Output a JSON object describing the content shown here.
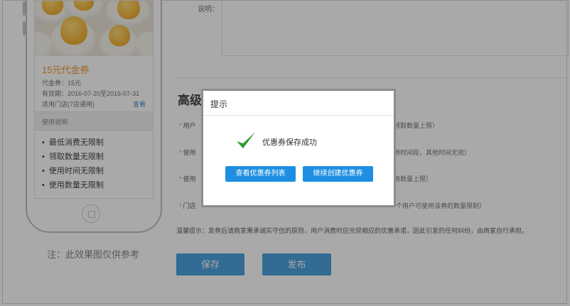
{
  "preview": {
    "coupon_title": "15元代金券",
    "face_value": "代金券：15元",
    "validity": "有效期：2016-07-20至2016-07-31",
    "stores": "适用门店(7店通用)",
    "view_link": "查看",
    "usage_header": "使用说明",
    "rules": [
      "最低消费无限制",
      "领取数量无限制",
      "使用时间无限制",
      "使用数量无限制"
    ],
    "note": "注：此效果图仅供参考"
  },
  "form": {
    "description_label": "说明：",
    "advanced_title": "高级",
    "fields": [
      {
        "label": "用户",
        "hint": "领取数量上限）"
      },
      {
        "label": "使用",
        "hint": "用时间段，其他时间无效）"
      },
      {
        "label": "使用",
        "hint": "用数量上限）"
      },
      {
        "label": "门店",
        "hint": "个用户可使用该券的数量限制）"
      }
    ],
    "tip": "温馨提示：发券后请商家秉承诚实守信的原则，用户消费时应兑现相应的优惠承诺，因此引发的任何纠纷，由商家自行承担。",
    "save_label": "保存",
    "publish_label": "发布"
  },
  "dialog": {
    "title": "提示",
    "message": "优惠券保存成功",
    "icon": "check-icon",
    "view_list_label": "查看优惠券列表",
    "create_more_label": "继续创建优惠券"
  },
  "colors": {
    "accent": "#1e8fe0",
    "coupon_orange": "#f08a1d",
    "check_green": "#2e9b2e"
  }
}
